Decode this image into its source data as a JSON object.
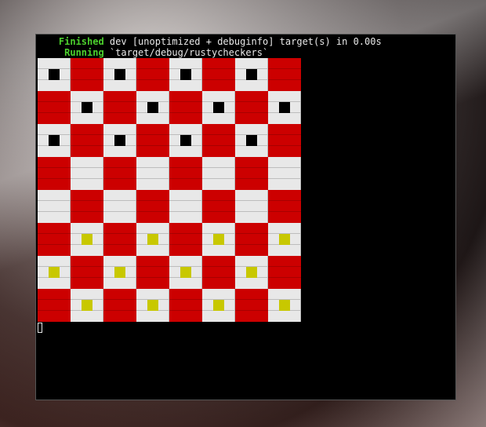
{
  "terminal": {
    "line1": {
      "status": "Finished",
      "text": " dev [unoptimized + debuginfo] target(s) in 0.00s",
      "indent": "    "
    },
    "line2": {
      "status": "Running",
      "text": " `target/debug/rustycheckers`",
      "indent": "     "
    }
  },
  "colors": {
    "status_green": "#4cd02d",
    "dark_square": "#cc0000",
    "light_square": "#e8e8e8",
    "black_piece": "#000000",
    "yellow_piece": "#c8c800"
  },
  "board": {
    "size": 8,
    "rows": [
      [
        "B",
        ".",
        "B",
        ".",
        "B",
        ".",
        "B",
        "."
      ],
      [
        ".",
        "B",
        ".",
        "B",
        ".",
        "B",
        ".",
        "B"
      ],
      [
        "B",
        ".",
        "B",
        ".",
        "B",
        ".",
        "B",
        "."
      ],
      [
        ".",
        ".",
        ".",
        ".",
        ".",
        ".",
        ".",
        "."
      ],
      [
        ".",
        ".",
        ".",
        ".",
        ".",
        ".",
        ".",
        "."
      ],
      [
        ".",
        "Y",
        ".",
        "Y",
        ".",
        "Y",
        ".",
        "Y"
      ],
      [
        "Y",
        ".",
        "Y",
        ".",
        "Y",
        ".",
        "Y",
        "."
      ],
      [
        ".",
        "Y",
        ".",
        "Y",
        ".",
        "Y",
        ".",
        "Y"
      ]
    ]
  }
}
